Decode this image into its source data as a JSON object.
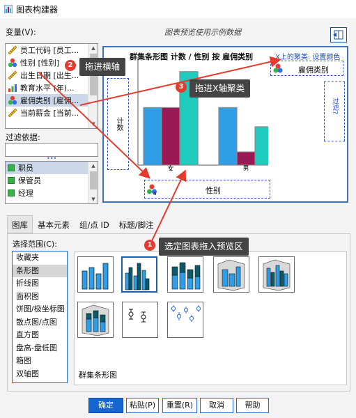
{
  "window": {
    "title": "图表构建器"
  },
  "variables": {
    "label": "变量(V):",
    "items": [
      {
        "label": "员工代码 [员工...",
        "icon": "scale-ruler-icon"
      },
      {
        "label": "性别 [性别]",
        "icon": "nominal-icon"
      },
      {
        "label": "出生日期 [出生...",
        "icon": "scale-ruler-icon"
      },
      {
        "label": "教育水平 (年)...",
        "icon": "ordinal-bars-icon"
      },
      {
        "label": "雇佣类别 [雇佣...",
        "icon": "nominal-icon"
      },
      {
        "label": "当前薪金 [当前...",
        "icon": "scale-ruler-icon"
      }
    ]
  },
  "filter": {
    "label": "过滤依据:",
    "value": "",
    "items": [
      {
        "label": "职员"
      },
      {
        "label": "保管员"
      },
      {
        "label": "经理"
      }
    ]
  },
  "preview": {
    "caption": "图表预览使用示例数据",
    "chart_title": "群集条形图 计数 / 性别 按 雇佣类别",
    "cluster_hint": "X上的聚类: 设置颜色",
    "legend_var": "雇佣类别",
    "y_label": "计数",
    "x_var": "性别",
    "side_drop": "过滤?",
    "categories": [
      "女",
      "男"
    ]
  },
  "chart_data": {
    "type": "bar",
    "categories": [
      "女",
      "男"
    ],
    "series": [
      {
        "color": "#2f9ee6",
        "values": [
          2.4,
          2.4
        ]
      },
      {
        "color": "#9b1a55",
        "values": [
          2.4,
          0.55
        ]
      },
      {
        "color": "#1ecbbd",
        "values": [
          3.9,
          1.6
        ]
      }
    ],
    "ylim": [
      0,
      4.3
    ]
  },
  "tabs": [
    "图库",
    "基本元素",
    "组/点 ID",
    "标题/脚注"
  ],
  "gallery": {
    "choose_label": "选择范围(C):",
    "categories": [
      "收藏夹",
      "条形图",
      "折线图",
      "面积图",
      "饼图/极坐标图",
      "散点图/点图",
      "直方图",
      "盘高-盘低图",
      "箱图",
      "双轴图"
    ],
    "selected_category": "条形图",
    "selected_chart_label": "群集条形图",
    "thumbnails": [
      "simple-bar-thumbnail-icon",
      "clustered-bar-thumbnail-icon",
      "stacked-bar-thumbnail-icon",
      "3d-bar-thumbnail-icon",
      "3d-clustered-bar-thumbnail-icon",
      "3d-stacked-bar-thumbnail-icon",
      "error-bar-thumbnail-icon",
      "clustered-error-bar-thumbnail-icon"
    ]
  },
  "annotations": [
    {
      "number": "1",
      "text": "选定图表拖入预览区"
    },
    {
      "number": "2",
      "text": "拖进横轴"
    },
    {
      "number": "3",
      "text": "拖进X轴聚类"
    }
  ],
  "buttons": {
    "ok": "确定",
    "paste": "粘贴(P)",
    "reset": "重置(R)",
    "cancel": "取消",
    "help": "帮助"
  },
  "colors": {
    "accent": "#1566d1",
    "annotation_red": "#e23b30",
    "callout_bg": "#444444",
    "drop_zone": "#3153c4"
  }
}
